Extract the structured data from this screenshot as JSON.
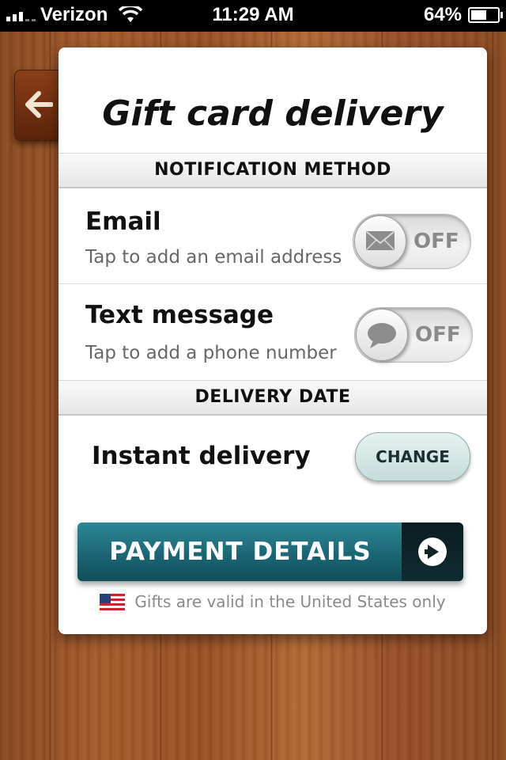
{
  "status_bar": {
    "carrier": "Verizon",
    "time": "11:29 AM",
    "battery": "64%",
    "battery_level": 0.64
  },
  "header": {
    "back_icon": "arrow-left-icon",
    "title": "Gift card delivery"
  },
  "notification": {
    "header": "NOTIFICATION METHOD",
    "email": {
      "title": "Email",
      "subtitle": "Tap to add an email address",
      "toggle_state": "OFF",
      "icon": "envelope-icon"
    },
    "text": {
      "title": "Text message",
      "subtitle": "Tap to add a phone number",
      "toggle_state": "OFF",
      "icon": "speech-bubble-icon"
    }
  },
  "delivery": {
    "header": "DELIVERY DATE",
    "option": "Instant delivery",
    "change_label": "CHANGE"
  },
  "payment": {
    "label": "PAYMENT DETAILS",
    "icon": "arrow-right-circle-icon",
    "accent": "#1b6674"
  },
  "footnote": {
    "text": "Gifts are valid in the United States only",
    "icon": "us-flag-icon"
  }
}
